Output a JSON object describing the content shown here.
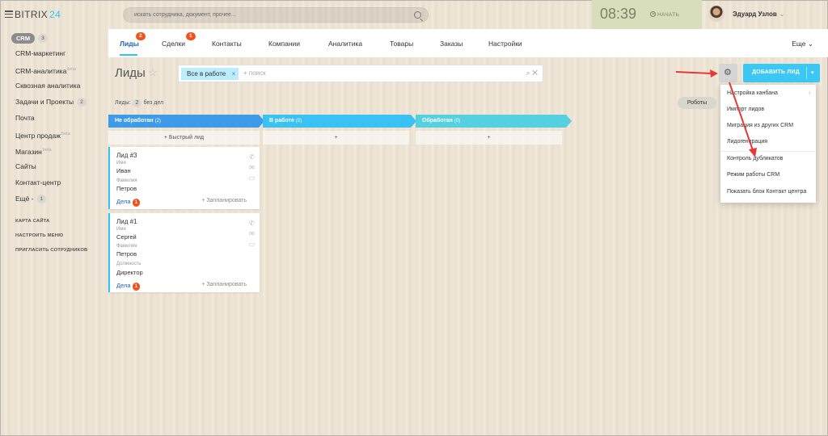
{
  "header": {
    "logo_main": "BITRIX",
    "logo_num": "24",
    "search_placeholder": "искать сотрудника, документ, прочее...",
    "clock_time": "08:39",
    "clock_action": "НАЧАТЬ",
    "user_name": "Эдуард Узлов"
  },
  "sidebar": {
    "crm_label": "CRM",
    "crm_count": "3",
    "items": [
      {
        "label": "CRM-маркетинг"
      },
      {
        "label": "CRM-аналитика",
        "beta": "beta"
      },
      {
        "label": "Сквозная аналитика"
      },
      {
        "label": "Задачи и Проекты",
        "count": "2"
      },
      {
        "label": "Почта"
      },
      {
        "label": "Центр продаж",
        "beta": "beta"
      },
      {
        "label": "Магазин",
        "beta": "beta"
      },
      {
        "label": "Сайты"
      },
      {
        "label": "Контакт-центр"
      },
      {
        "label": "Ещё -",
        "count": "1"
      }
    ],
    "links": [
      "КАРТА САЙТА",
      "НАСТРОИТЬ МЕНЮ",
      "ПРИГЛАСИТЬ СОТРУДНИКОВ"
    ]
  },
  "tabs": {
    "items": [
      {
        "label": "Лиды",
        "badge": "2"
      },
      {
        "label": "Сделки",
        "badge": "1"
      },
      {
        "label": "Контакты"
      },
      {
        "label": "Компании"
      },
      {
        "label": "Аналитика"
      },
      {
        "label": "Товары"
      },
      {
        "label": "Заказы"
      },
      {
        "label": "Настройки"
      }
    ],
    "more": "Еще"
  },
  "page": {
    "title": "Лиды",
    "filter_tag": "Все в работе",
    "filter_search": "+ поиск",
    "add_button": "ДОБАВИТЬ ЛИД",
    "counters_label": "Лиды:",
    "counters_value": "2",
    "counters_suffix": "без дел",
    "robots": "Роботы"
  },
  "kanban": {
    "columns": [
      {
        "title": "Не обработан",
        "count": "(2)",
        "color": "#3d9be8"
      },
      {
        "title": "В работе",
        "count": "(0)",
        "color": "#39c2f3"
      },
      {
        "title": "Обработан",
        "count": "(0)",
        "color": "#55d0e0"
      }
    ],
    "quick_add": "+ Быстрый лид",
    "plus": "+",
    "cards": [
      {
        "title": "Лид #3",
        "fields": [
          {
            "label": "Имя",
            "value": "Иван"
          },
          {
            "label": "Фамилия",
            "value": "Петров"
          }
        ],
        "deals_label": "Дела",
        "deals_count": "1",
        "plan": "+ Запланировать"
      },
      {
        "title": "Лид #1",
        "fields": [
          {
            "label": "Имя",
            "value": "Сергей"
          },
          {
            "label": "Фамилия",
            "value": "Петров"
          },
          {
            "label": "Должность",
            "value": "Директор"
          }
        ],
        "deals_label": "Дела",
        "deals_count": "1",
        "plan": "+ Запланировать"
      }
    ]
  },
  "menu": {
    "items": [
      "Настройка канбана",
      "Импорт лидов",
      "Миграция из других CRM",
      "Лидогенерация",
      "Контроль дубликатов",
      "Режим работы CRM",
      "Показать блок Контакт центра"
    ]
  },
  "colors": {
    "accent": "#2fc6f6",
    "active_tab": "#2067b0",
    "badge": "#f2521b",
    "arrow": "#e53935"
  }
}
